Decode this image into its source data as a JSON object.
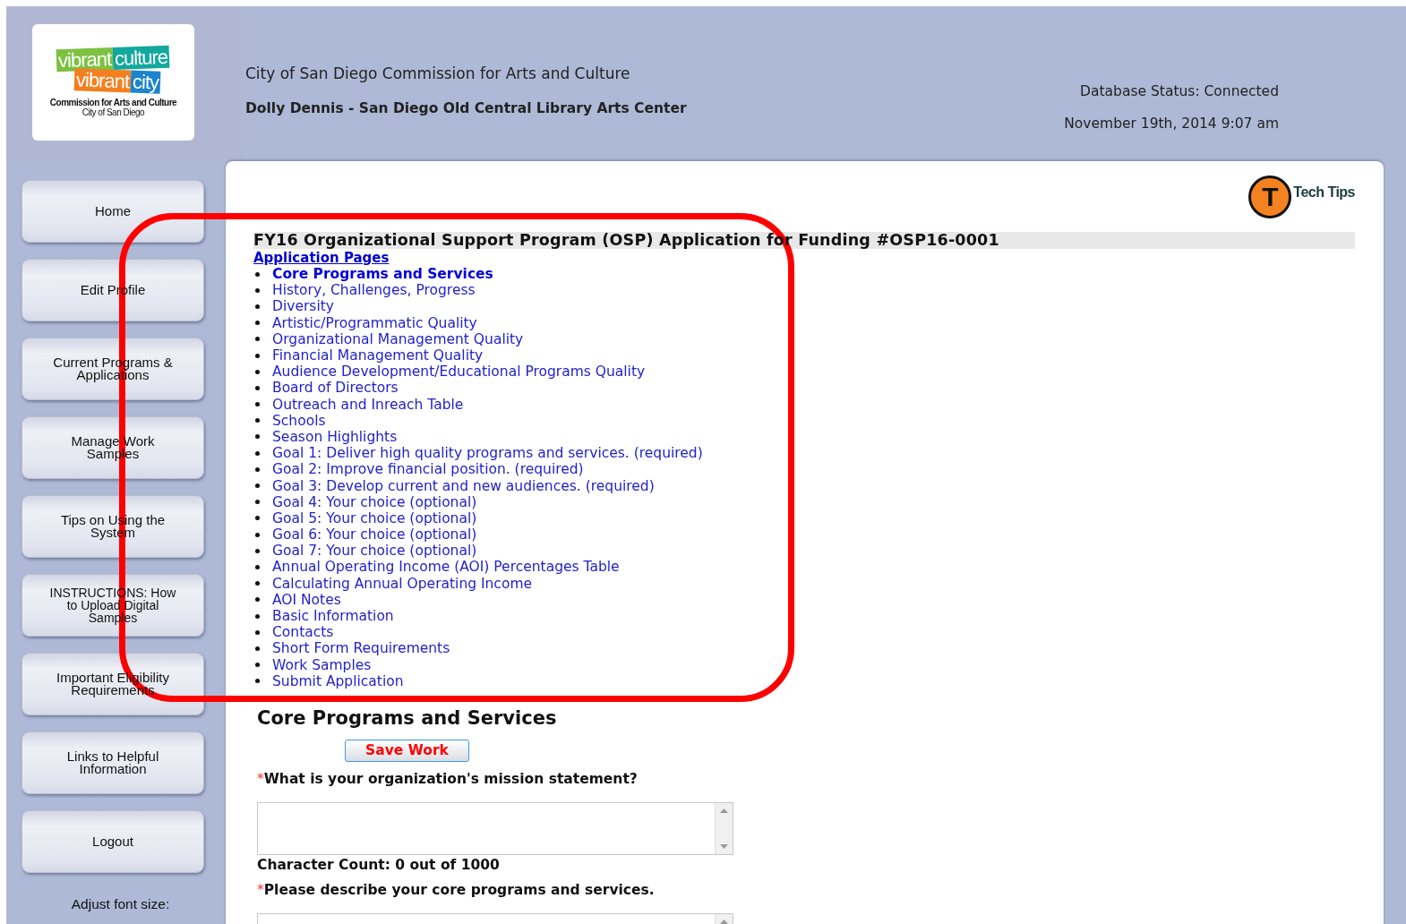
{
  "logo": {
    "line1": [
      "vibrant",
      "culture"
    ],
    "line2": [
      "vibrant",
      "city"
    ],
    "org": "Commission for Arts and Culture",
    "city": "City of San Diego"
  },
  "header": {
    "commission": "City of San Diego Commission for Arts and Culture",
    "user": "Dolly Dennis - San Diego Old Central Library Arts Center",
    "status": "Database Status: Connected",
    "datetime": "November 19th, 2014 9:07 am"
  },
  "sidebar": {
    "items": [
      {
        "label": "Home"
      },
      {
        "label": "Edit Profile"
      },
      {
        "label": "Current Programs & Applications"
      },
      {
        "label": "Manage Work Samples"
      },
      {
        "label": "Tips on Using the System"
      },
      {
        "label": "INSTRUCTIONS: How to Upload Digital Samples"
      },
      {
        "label": "Important Eligibility Requirements"
      },
      {
        "label": "Links to Helpful Information"
      },
      {
        "label": "Logout"
      }
    ],
    "font_size_label": "Adjust font size:"
  },
  "tech_tips": {
    "icon_letter": "T",
    "label": "Tech Tips"
  },
  "application": {
    "title": "FY16 Organizational Support Program (OSP) Application for Funding #OSP16-0001",
    "pages_heading": "Application Pages",
    "pages": [
      {
        "label": "Core Programs and Services",
        "selected": true
      },
      {
        "label": "History, Challenges, Progress",
        "selected": false
      },
      {
        "label": "Diversity",
        "selected": false
      },
      {
        "label": "Artistic/Programmatic Quality",
        "selected": false
      },
      {
        "label": "Organizational Management Quality",
        "selected": false
      },
      {
        "label": "Financial Management Quality",
        "selected": false
      },
      {
        "label": "Audience Development/Educational Programs Quality",
        "selected": false
      },
      {
        "label": "Board of Directors",
        "selected": false
      },
      {
        "label": "Outreach and Inreach Table",
        "selected": false
      },
      {
        "label": "Schools",
        "selected": false
      },
      {
        "label": "Season Highlights",
        "selected": false
      },
      {
        "label": "Goal 1: Deliver high quality programs and services. (required)",
        "selected": false
      },
      {
        "label": "Goal 2: Improve financial position. (required)",
        "selected": false
      },
      {
        "label": "Goal 3: Develop current and new audiences. (required)",
        "selected": false
      },
      {
        "label": "Goal 4: Your choice (optional)",
        "selected": false
      },
      {
        "label": "Goal 5: Your choice (optional)",
        "selected": false
      },
      {
        "label": "Goal 6: Your choice (optional)",
        "selected": false
      },
      {
        "label": "Goal 7: Your choice (optional)",
        "selected": false
      },
      {
        "label": "Annual Operating Income (AOI) Percentages Table",
        "selected": false
      },
      {
        "label": "Calculating Annual Operating Income",
        "selected": false
      },
      {
        "label": "AOI Notes",
        "selected": false
      },
      {
        "label": "Basic Information",
        "selected": false
      },
      {
        "label": "Contacts",
        "selected": false
      },
      {
        "label": "Short Form Requirements",
        "selected": false
      },
      {
        "label": "Work Samples",
        "selected": false
      },
      {
        "label": "Submit Application",
        "selected": false
      }
    ]
  },
  "section": {
    "heading": "Core Programs and Services",
    "save_button": "Save Work",
    "questions": [
      {
        "marker": "*",
        "label": "What is your organization's mission statement?",
        "char_count": "Character Count: 0 out of 1000"
      },
      {
        "marker": "*",
        "label": "Please describe your core programs and services."
      }
    ]
  }
}
